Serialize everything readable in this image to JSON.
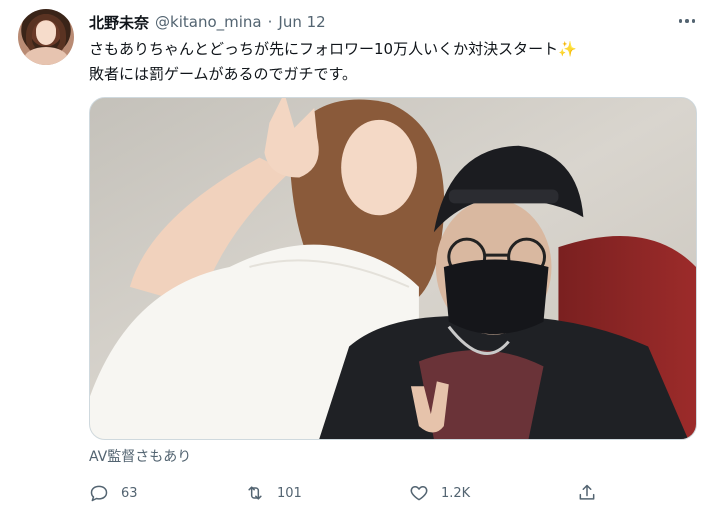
{
  "tweet": {
    "author_name": "北野未奈",
    "author_handle": "@kitano_mina",
    "separator": "·",
    "date": "Jun 12",
    "text_line1": "さもありちゃんとどっちが先にフォロワー10万人いくか対決スタート",
    "sparkle": "✨",
    "text_line2": "敗者には罰ゲームがあるのでガチです。",
    "image_caption": "AV監督さもあり"
  },
  "actions": {
    "reply_count": "63",
    "retweet_count": "101",
    "like_count": "1.2K"
  },
  "icons": {
    "more": "more-icon",
    "reply": "reply-icon",
    "retweet": "retweet-icon",
    "like": "heart-icon",
    "share": "share-icon"
  }
}
